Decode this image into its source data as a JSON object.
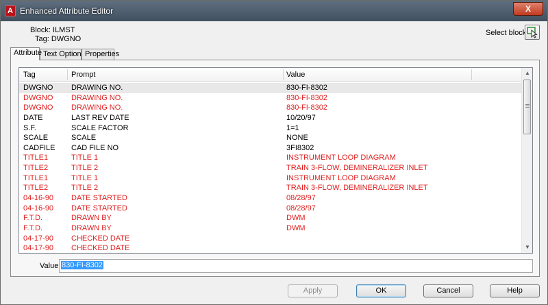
{
  "window": {
    "title": "Enhanced Attribute Editor",
    "close_glyph": "X"
  },
  "header": {
    "block": "Block: ILMST",
    "tag": "Tag: DWGNO",
    "select_block_label": "Select block"
  },
  "tabs": [
    {
      "label": "Attribute",
      "active": true
    },
    {
      "label": "Text Options",
      "active": false
    },
    {
      "label": "Properties",
      "active": false
    }
  ],
  "list": {
    "columns": {
      "tag": "Tag",
      "prompt": "Prompt",
      "value": "Value"
    },
    "rows": [
      {
        "tag": "DWGNO",
        "prompt": "DRAWING NO.",
        "value": "830-FI-8302",
        "color": "#000000",
        "selected": true
      },
      {
        "tag": "DWGNO",
        "prompt": "DRAWING NO.",
        "value": "830-FI-8302",
        "color": "#e02020"
      },
      {
        "tag": "DWGNO",
        "prompt": "DRAWING NO.",
        "value": "830-FI-8302",
        "color": "#e02020"
      },
      {
        "tag": "DATE",
        "prompt": "LAST REV DATE",
        "value": "10/20/97",
        "color": "#000000"
      },
      {
        "tag": "S.F.",
        "prompt": "SCALE FACTOR",
        "value": "1=1",
        "color": "#000000"
      },
      {
        "tag": "SCALE",
        "prompt": "SCALE",
        "value": "NONE",
        "color": "#000000"
      },
      {
        "tag": "CADFILE",
        "prompt": "CAD FILE NO",
        "value": "3FI8302",
        "color": "#000000"
      },
      {
        "tag": "TITLE1",
        "prompt": "TITLE 1",
        "value": "INSTRUMENT LOOP DIAGRAM",
        "color": "#e02020"
      },
      {
        "tag": "TITLE2",
        "prompt": "TITLE 2",
        "value": "TRAIN 3-FLOW, DEMINERALIZER INLET",
        "color": "#e02020"
      },
      {
        "tag": "TITLE1",
        "prompt": "TITLE 1",
        "value": "INSTRUMENT LOOP DIAGRAM",
        "color": "#e02020"
      },
      {
        "tag": "TITLE2",
        "prompt": "TITLE 2",
        "value": "TRAIN 3-FLOW, DEMINERALIZER INLET",
        "color": "#e02020"
      },
      {
        "tag": "04-16-90",
        "prompt": "DATE STARTED",
        "value": "08/28/97",
        "color": "#e02020"
      },
      {
        "tag": "04-16-90",
        "prompt": "DATE STARTED",
        "value": "08/28/97",
        "color": "#e02020"
      },
      {
        "tag": "F.T.D.",
        "prompt": "DRAWN BY",
        "value": "DWM",
        "color": "#e02020"
      },
      {
        "tag": "F.T.D.",
        "prompt": "DRAWN BY",
        "value": "DWM",
        "color": "#e02020"
      },
      {
        "tag": "04-17-90",
        "prompt": "CHECKED DATE",
        "value": "",
        "color": "#e02020"
      },
      {
        "tag": "04-17-90",
        "prompt": "CHECKED DATE",
        "value": "",
        "color": "#e02020"
      }
    ]
  },
  "value_field": {
    "label": "Value:",
    "value": "830-FI-8302"
  },
  "buttons": {
    "apply": "Apply",
    "ok": "OK",
    "cancel": "Cancel",
    "help": "Help"
  },
  "icons": {
    "app": "autocad-icon",
    "select_block": "select-object-icon",
    "scroll_up": "arrow-up-icon",
    "scroll_down": "arrow-down-icon"
  }
}
